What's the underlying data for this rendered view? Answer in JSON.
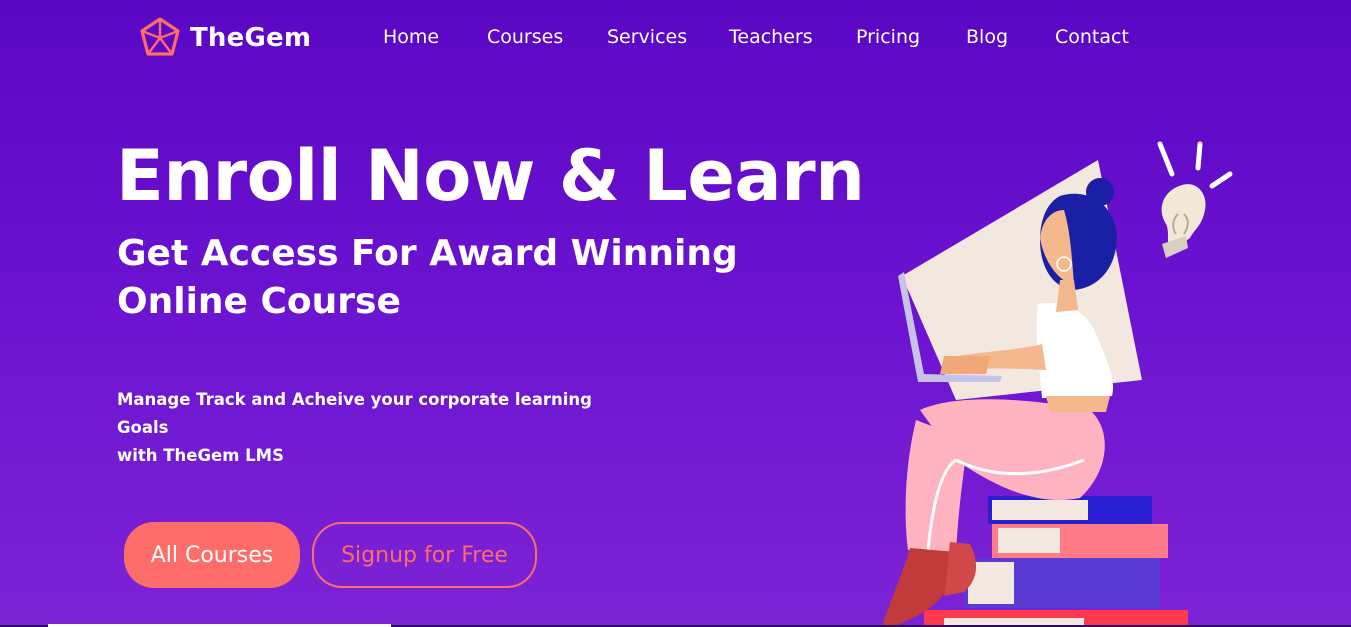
{
  "brand": {
    "name": "TheGem",
    "logo_icon": "pentagon-gem-icon",
    "logo_color": "#ff6d6a"
  },
  "nav": {
    "items": [
      {
        "label": "Home"
      },
      {
        "label": "Courses"
      },
      {
        "label": "Services"
      },
      {
        "label": "Teachers"
      },
      {
        "label": "Pricing"
      },
      {
        "label": "Blog"
      },
      {
        "label": "Contact"
      }
    ]
  },
  "hero": {
    "title": "Enroll Now & Learn",
    "subtitle_line1": "Get Access For Award Winning",
    "subtitle_line2": "Online Course",
    "description_line1": "Manage Track and Acheive your corporate learning Goals",
    "description_line2": "with TheGem LMS",
    "primary_button": "All Courses",
    "secondary_button": "Signup for Free",
    "accent_color": "#ff6d6a",
    "background_top": "#5a07c4",
    "background_bottom": "#7d23d6"
  },
  "illustration": {
    "subject": "woman-with-laptop-on-books-illustration",
    "icon": "lightbulb-icon"
  }
}
